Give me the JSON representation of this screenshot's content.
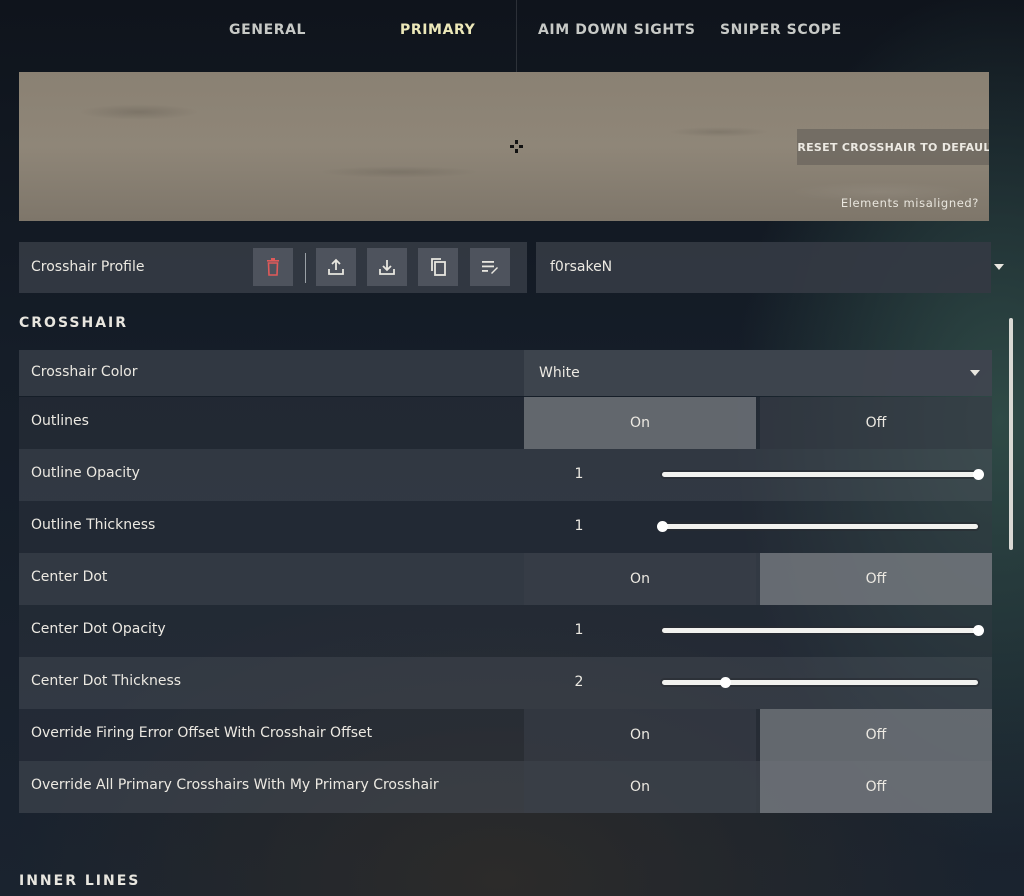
{
  "tabs": [
    {
      "label": "GENERAL",
      "active": false
    },
    {
      "label": "PRIMARY",
      "active": true
    },
    {
      "label": "AIM DOWN SIGHTS",
      "active": false
    },
    {
      "label": "SNIPER SCOPE",
      "active": false
    }
  ],
  "preview": {
    "reset_label": "RESET CROSSHAIR TO DEFAULT",
    "misaligned_label": "Elements misaligned?"
  },
  "profile": {
    "label": "Crosshair Profile",
    "buttons": [
      "trash-icon",
      "upload-icon",
      "download-icon",
      "copy-icon",
      "rename-icon"
    ],
    "selected": "f0rsakeN"
  },
  "sections": {
    "crosshair": "CROSSHAIR",
    "inner_lines": "INNER LINES"
  },
  "settings": {
    "color": {
      "label": "Crosshair Color",
      "value": "White"
    },
    "outlines": {
      "label": "Outlines",
      "on": "On",
      "off": "Off",
      "selected": "On"
    },
    "outline_opacity": {
      "label": "Outline Opacity",
      "value": "1",
      "fraction": 1.0
    },
    "outline_thickness": {
      "label": "Outline Thickness",
      "value": "1",
      "fraction": 0.0
    },
    "center_dot": {
      "label": "Center Dot",
      "on": "On",
      "off": "Off",
      "selected": "Off"
    },
    "center_dot_opacity": {
      "label": "Center Dot Opacity",
      "value": "1",
      "fraction": 1.0
    },
    "center_dot_thickness": {
      "label": "Center Dot Thickness",
      "value": "2",
      "fraction": 0.2
    },
    "override_firing": {
      "label": "Override Firing Error Offset With Crosshair Offset",
      "on": "On",
      "off": "Off",
      "selected": "Off"
    },
    "override_all": {
      "label": "Override All Primary Crosshairs With My Primary Crosshair",
      "on": "On",
      "off": "Off",
      "selected": "Off"
    }
  },
  "colors": {
    "active_tab": "#ece8b9",
    "delete_icon": "#e05a5a",
    "selected_toggle": "#7a7e84"
  }
}
